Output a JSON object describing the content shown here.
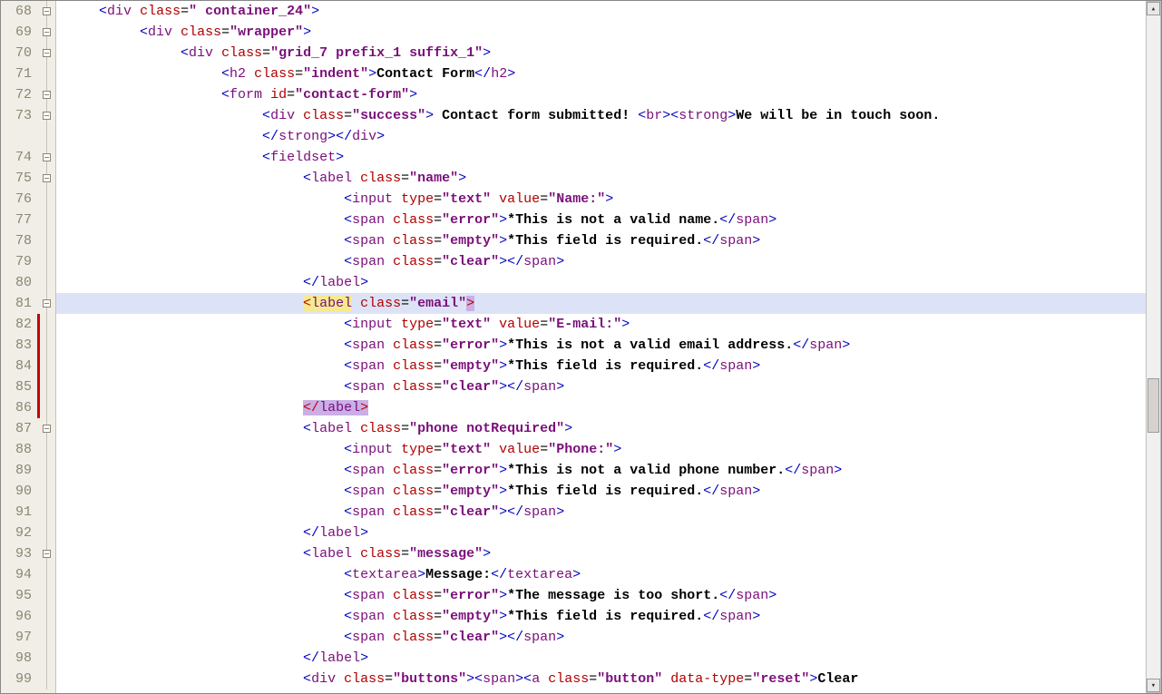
{
  "lineStart": 68,
  "highlightLine": 81,
  "foldLines": [
    68,
    69,
    70,
    72,
    73,
    74,
    75,
    81,
    87,
    93
  ],
  "redBarRange": [
    82,
    86
  ],
  "code": [
    {
      "n": 68,
      "i": 1,
      "seg": [
        [
          "ang",
          "<"
        ],
        [
          "tag",
          "div"
        ],
        [
          "sp",
          " "
        ],
        [
          "attr",
          "class"
        ],
        [
          "eq",
          "="
        ],
        [
          "val",
          "\" container_24\""
        ],
        [
          "ang",
          ">"
        ]
      ]
    },
    {
      "n": 69,
      "i": 2,
      "seg": [
        [
          "ang",
          "<"
        ],
        [
          "tag",
          "div"
        ],
        [
          "sp",
          " "
        ],
        [
          "attr",
          "class"
        ],
        [
          "eq",
          "="
        ],
        [
          "val",
          "\"wrapper\""
        ],
        [
          "ang",
          ">"
        ]
      ]
    },
    {
      "n": 70,
      "i": 3,
      "seg": [
        [
          "ang",
          "<"
        ],
        [
          "tag",
          "div"
        ],
        [
          "sp",
          " "
        ],
        [
          "attr",
          "class"
        ],
        [
          "eq",
          "="
        ],
        [
          "val",
          "\"grid_7 prefix_1 suffix_1\""
        ],
        [
          "ang",
          ">"
        ]
      ]
    },
    {
      "n": 71,
      "i": 4,
      "seg": [
        [
          "ang",
          "<"
        ],
        [
          "tag",
          "h2"
        ],
        [
          "sp",
          " "
        ],
        [
          "attr",
          "class"
        ],
        [
          "eq",
          "="
        ],
        [
          "val",
          "\"indent\""
        ],
        [
          "ang",
          ">"
        ],
        [
          "text",
          "Contact Form"
        ],
        [
          "ang",
          "</"
        ],
        [
          "tag",
          "h2"
        ],
        [
          "ang",
          ">"
        ]
      ]
    },
    {
      "n": 72,
      "i": 4,
      "seg": [
        [
          "ang",
          "<"
        ],
        [
          "tag",
          "form"
        ],
        [
          "sp",
          " "
        ],
        [
          "attr",
          "id"
        ],
        [
          "eq",
          "="
        ],
        [
          "val",
          "\"contact-form\""
        ],
        [
          "ang",
          ">"
        ]
      ]
    },
    {
      "n": 73,
      "i": 5,
      "seg": [
        [
          "ang",
          "<"
        ],
        [
          "tag",
          "div"
        ],
        [
          "sp",
          " "
        ],
        [
          "attr",
          "class"
        ],
        [
          "eq",
          "="
        ],
        [
          "val",
          "\"success\""
        ],
        [
          "ang",
          ">"
        ],
        [
          "text",
          " Contact form submitted! "
        ],
        [
          "ang",
          "<"
        ],
        [
          "tag",
          "br"
        ],
        [
          "ang",
          "><"
        ],
        [
          "tag",
          "strong"
        ],
        [
          "ang",
          ">"
        ],
        [
          "text",
          "We will be in touch soon."
        ]
      ],
      "wrap": {
        "i": 5,
        "seg": [
          [
            "ang",
            "</"
          ],
          [
            "tag",
            "strong"
          ],
          [
            "ang",
            "></"
          ],
          [
            "tag",
            "div"
          ],
          [
            "ang",
            ">"
          ]
        ]
      }
    },
    {
      "n": 74,
      "i": 5,
      "seg": [
        [
          "ang",
          "<"
        ],
        [
          "tag",
          "fieldset"
        ],
        [
          "ang",
          ">"
        ]
      ]
    },
    {
      "n": 75,
      "i": 6,
      "seg": [
        [
          "ang",
          "<"
        ],
        [
          "tag",
          "label"
        ],
        [
          "sp",
          " "
        ],
        [
          "attr",
          "class"
        ],
        [
          "eq",
          "="
        ],
        [
          "val",
          "\"name\""
        ],
        [
          "ang",
          ">"
        ]
      ]
    },
    {
      "n": 76,
      "i": 7,
      "seg": [
        [
          "ang",
          "<"
        ],
        [
          "tag",
          "input"
        ],
        [
          "sp",
          " "
        ],
        [
          "attr",
          "type"
        ],
        [
          "eq",
          "="
        ],
        [
          "val",
          "\"text\""
        ],
        [
          "sp",
          " "
        ],
        [
          "attr",
          "value"
        ],
        [
          "eq",
          "="
        ],
        [
          "val",
          "\"Name:\""
        ],
        [
          "ang",
          ">"
        ]
      ]
    },
    {
      "n": 77,
      "i": 7,
      "seg": [
        [
          "ang",
          "<"
        ],
        [
          "tag",
          "span"
        ],
        [
          "sp",
          " "
        ],
        [
          "attr",
          "class"
        ],
        [
          "eq",
          "="
        ],
        [
          "val",
          "\"error\""
        ],
        [
          "ang",
          ">"
        ],
        [
          "text",
          "*This is not a valid name."
        ],
        [
          "ang",
          "</"
        ],
        [
          "tag",
          "span"
        ],
        [
          "ang",
          ">"
        ]
      ]
    },
    {
      "n": 78,
      "i": 7,
      "seg": [
        [
          "ang",
          "<"
        ],
        [
          "tag",
          "span"
        ],
        [
          "sp",
          " "
        ],
        [
          "attr",
          "class"
        ],
        [
          "eq",
          "="
        ],
        [
          "val",
          "\"empty\""
        ],
        [
          "ang",
          ">"
        ],
        [
          "text",
          "*This field is required."
        ],
        [
          "ang",
          "</"
        ],
        [
          "tag",
          "span"
        ],
        [
          "ang",
          ">"
        ]
      ]
    },
    {
      "n": 79,
      "i": 7,
      "seg": [
        [
          "ang",
          "<"
        ],
        [
          "tag",
          "span"
        ],
        [
          "sp",
          " "
        ],
        [
          "attr",
          "class"
        ],
        [
          "eq",
          "="
        ],
        [
          "val",
          "\"clear\""
        ],
        [
          "ang",
          "></"
        ],
        [
          "tag",
          "span"
        ],
        [
          "ang",
          ">"
        ]
      ]
    },
    {
      "n": 80,
      "i": 6,
      "seg": [
        [
          "ang",
          "</"
        ],
        [
          "tag",
          "label"
        ],
        [
          "ang",
          ">"
        ]
      ]
    },
    {
      "n": 81,
      "i": 6,
      "hl": true,
      "seg": [
        [
          "hl-open",
          "<label "
        ],
        [
          "hl-attr-open",
          " "
        ],
        [
          "attr",
          "class"
        ],
        [
          "eq",
          "="
        ],
        [
          "val",
          "\"email\""
        ],
        [
          "hl-close-ang",
          ">"
        ]
      ]
    },
    {
      "n": 82,
      "i": 7,
      "seg": [
        [
          "ang",
          "<"
        ],
        [
          "tag",
          "input"
        ],
        [
          "sp",
          " "
        ],
        [
          "attr",
          "type"
        ],
        [
          "eq",
          "="
        ],
        [
          "val",
          "\"text\""
        ],
        [
          "sp",
          " "
        ],
        [
          "attr",
          "value"
        ],
        [
          "eq",
          "="
        ],
        [
          "val",
          "\"E-mail:\""
        ],
        [
          "ang",
          ">"
        ]
      ]
    },
    {
      "n": 83,
      "i": 7,
      "seg": [
        [
          "ang",
          "<"
        ],
        [
          "tag",
          "span"
        ],
        [
          "sp",
          " "
        ],
        [
          "attr",
          "class"
        ],
        [
          "eq",
          "="
        ],
        [
          "val",
          "\"error\""
        ],
        [
          "ang",
          ">"
        ],
        [
          "text",
          "*This is not a valid email address."
        ],
        [
          "ang",
          "</"
        ],
        [
          "tag",
          "span"
        ],
        [
          "ang",
          ">"
        ]
      ]
    },
    {
      "n": 84,
      "i": 7,
      "seg": [
        [
          "ang",
          "<"
        ],
        [
          "tag",
          "span"
        ],
        [
          "sp",
          " "
        ],
        [
          "attr",
          "class"
        ],
        [
          "eq",
          "="
        ],
        [
          "val",
          "\"empty\""
        ],
        [
          "ang",
          ">"
        ],
        [
          "text",
          "*This field is required."
        ],
        [
          "ang",
          "</"
        ],
        [
          "tag",
          "span"
        ],
        [
          "ang",
          ">"
        ]
      ]
    },
    {
      "n": 85,
      "i": 7,
      "seg": [
        [
          "ang",
          "<"
        ],
        [
          "tag",
          "span"
        ],
        [
          "sp",
          " "
        ],
        [
          "attr",
          "class"
        ],
        [
          "eq",
          "="
        ],
        [
          "val",
          "\"clear\""
        ],
        [
          "ang",
          "></"
        ],
        [
          "tag",
          "span"
        ],
        [
          "ang",
          ">"
        ]
      ]
    },
    {
      "n": 86,
      "i": 6,
      "seg": [
        [
          "hl-close",
          "</label>"
        ]
      ]
    },
    {
      "n": 87,
      "i": 6,
      "seg": [
        [
          "ang",
          "<"
        ],
        [
          "tag",
          "label"
        ],
        [
          "sp",
          " "
        ],
        [
          "attr",
          "class"
        ],
        [
          "eq",
          "="
        ],
        [
          "val",
          "\"phone notRequired\""
        ],
        [
          "ang",
          ">"
        ]
      ]
    },
    {
      "n": 88,
      "i": 7,
      "seg": [
        [
          "ang",
          "<"
        ],
        [
          "tag",
          "input"
        ],
        [
          "sp",
          " "
        ],
        [
          "attr",
          "type"
        ],
        [
          "eq",
          "="
        ],
        [
          "val",
          "\"text\""
        ],
        [
          "sp",
          " "
        ],
        [
          "attr",
          "value"
        ],
        [
          "eq",
          "="
        ],
        [
          "val",
          "\"Phone:\""
        ],
        [
          "ang",
          ">"
        ]
      ]
    },
    {
      "n": 89,
      "i": 7,
      "seg": [
        [
          "ang",
          "<"
        ],
        [
          "tag",
          "span"
        ],
        [
          "sp",
          " "
        ],
        [
          "attr",
          "class"
        ],
        [
          "eq",
          "="
        ],
        [
          "val",
          "\"error\""
        ],
        [
          "ang",
          ">"
        ],
        [
          "text",
          "*This is not a valid phone number."
        ],
        [
          "ang",
          "</"
        ],
        [
          "tag",
          "span"
        ],
        [
          "ang",
          ">"
        ]
      ]
    },
    {
      "n": 90,
      "i": 7,
      "seg": [
        [
          "ang",
          "<"
        ],
        [
          "tag",
          "span"
        ],
        [
          "sp",
          " "
        ],
        [
          "attr",
          "class"
        ],
        [
          "eq",
          "="
        ],
        [
          "val",
          "\"empty\""
        ],
        [
          "ang",
          ">"
        ],
        [
          "text",
          "*This field is required."
        ],
        [
          "ang",
          "</"
        ],
        [
          "tag",
          "span"
        ],
        [
          "ang",
          ">"
        ]
      ]
    },
    {
      "n": 91,
      "i": 7,
      "seg": [
        [
          "ang",
          "<"
        ],
        [
          "tag",
          "span"
        ],
        [
          "sp",
          " "
        ],
        [
          "attr",
          "class"
        ],
        [
          "eq",
          "="
        ],
        [
          "val",
          "\"clear\""
        ],
        [
          "ang",
          "></"
        ],
        [
          "tag",
          "span"
        ],
        [
          "ang",
          ">"
        ]
      ]
    },
    {
      "n": 92,
      "i": 6,
      "seg": [
        [
          "ang",
          "</"
        ],
        [
          "tag",
          "label"
        ],
        [
          "ang",
          ">"
        ]
      ]
    },
    {
      "n": 93,
      "i": 6,
      "seg": [
        [
          "ang",
          "<"
        ],
        [
          "tag",
          "label"
        ],
        [
          "sp",
          " "
        ],
        [
          "attr",
          "class"
        ],
        [
          "eq",
          "="
        ],
        [
          "val",
          "\"message\""
        ],
        [
          "ang",
          ">"
        ]
      ]
    },
    {
      "n": 94,
      "i": 7,
      "seg": [
        [
          "ang",
          "<"
        ],
        [
          "tag",
          "textarea"
        ],
        [
          "ang",
          ">"
        ],
        [
          "text",
          "Message:"
        ],
        [
          "ang",
          "</"
        ],
        [
          "tag",
          "textarea"
        ],
        [
          "ang",
          ">"
        ]
      ]
    },
    {
      "n": 95,
      "i": 7,
      "seg": [
        [
          "ang",
          "<"
        ],
        [
          "tag",
          "span"
        ],
        [
          "sp",
          " "
        ],
        [
          "attr",
          "class"
        ],
        [
          "eq",
          "="
        ],
        [
          "val",
          "\"error\""
        ],
        [
          "ang",
          ">"
        ],
        [
          "text",
          "*The message is too short."
        ],
        [
          "ang",
          "</"
        ],
        [
          "tag",
          "span"
        ],
        [
          "ang",
          ">"
        ]
      ]
    },
    {
      "n": 96,
      "i": 7,
      "seg": [
        [
          "ang",
          "<"
        ],
        [
          "tag",
          "span"
        ],
        [
          "sp",
          " "
        ],
        [
          "attr",
          "class"
        ],
        [
          "eq",
          "="
        ],
        [
          "val",
          "\"empty\""
        ],
        [
          "ang",
          ">"
        ],
        [
          "text",
          "*This field is required."
        ],
        [
          "ang",
          "</"
        ],
        [
          "tag",
          "span"
        ],
        [
          "ang",
          ">"
        ]
      ]
    },
    {
      "n": 97,
      "i": 7,
      "seg": [
        [
          "ang",
          "<"
        ],
        [
          "tag",
          "span"
        ],
        [
          "sp",
          " "
        ],
        [
          "attr",
          "class"
        ],
        [
          "eq",
          "="
        ],
        [
          "val",
          "\"clear\""
        ],
        [
          "ang",
          "></"
        ],
        [
          "tag",
          "span"
        ],
        [
          "ang",
          ">"
        ]
      ]
    },
    {
      "n": 98,
      "i": 6,
      "seg": [
        [
          "ang",
          "</"
        ],
        [
          "tag",
          "label"
        ],
        [
          "ang",
          ">"
        ]
      ]
    },
    {
      "n": 99,
      "i": 6,
      "seg": [
        [
          "ang",
          "<"
        ],
        [
          "tag",
          "div"
        ],
        [
          "sp",
          " "
        ],
        [
          "attr",
          "class"
        ],
        [
          "eq",
          "="
        ],
        [
          "val",
          "\"buttons\""
        ],
        [
          "ang",
          "><"
        ],
        [
          "tag",
          "span"
        ],
        [
          "ang",
          "><"
        ],
        [
          "tag",
          "a"
        ],
        [
          "sp",
          " "
        ],
        [
          "attr",
          "class"
        ],
        [
          "eq",
          "="
        ],
        [
          "val",
          "\"button\""
        ],
        [
          "sp",
          " "
        ],
        [
          "attr",
          "data-type"
        ],
        [
          "eq",
          "="
        ],
        [
          "val",
          "\"reset\""
        ],
        [
          "ang",
          ">"
        ],
        [
          "text",
          "Clear"
        ]
      ]
    }
  ],
  "scrollbar": {
    "upGlyph": "▴",
    "downGlyph": "▾"
  }
}
